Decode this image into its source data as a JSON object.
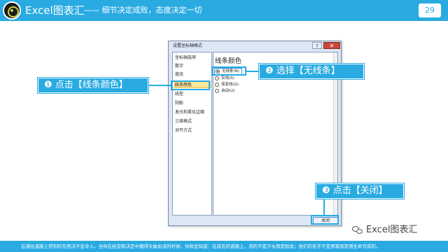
{
  "header": {
    "title": "Excel图表汇",
    "subtitle": "—— 细节决定成败，态度决定一切",
    "page_number": "29"
  },
  "dialog": {
    "title": "设置坐标轴格式",
    "help_label": "?",
    "close_icon_label": "✕",
    "categories": [
      {
        "label": "坐标轴选项",
        "selected": false
      },
      {
        "label": "数字",
        "selected": false
      },
      {
        "label": "填充",
        "selected": false
      },
      {
        "label": "线条颜色",
        "selected": true
      },
      {
        "label": "线型",
        "selected": false
      },
      {
        "label": "阴影",
        "selected": false
      },
      {
        "label": "发光和柔化边缘",
        "selected": false
      },
      {
        "label": "三维格式",
        "selected": false
      },
      {
        "label": "对齐方式",
        "selected": false
      }
    ],
    "panel_heading": "线条颜色",
    "options": [
      {
        "label": "无线条(N)",
        "checked": true
      },
      {
        "label": "实线(S)",
        "checked": false
      },
      {
        "label": "渐变线(G)",
        "checked": false
      },
      {
        "label": "自动(U)",
        "checked": false
      }
    ],
    "close_button": "关闭"
  },
  "callouts": {
    "step1": "❶ 点击【线条颜色】",
    "step2": "❷ 选择【无线条】",
    "step3": "❸ 点击【关闭】"
  },
  "brand": {
    "text": "Excel图表汇",
    "icon": "wechat-icon"
  },
  "footer": {
    "text": "在通往道路上得到的东西决不会令人。当你在经受和决定中磨得头破血流的时候，你就会知道：在成名的道路上，流的不是汗水而是鲜血；他们的名字不是用笔而是用生命写成的。"
  },
  "colors": {
    "accent": "#29abe2",
    "selection": "#fde79a"
  }
}
